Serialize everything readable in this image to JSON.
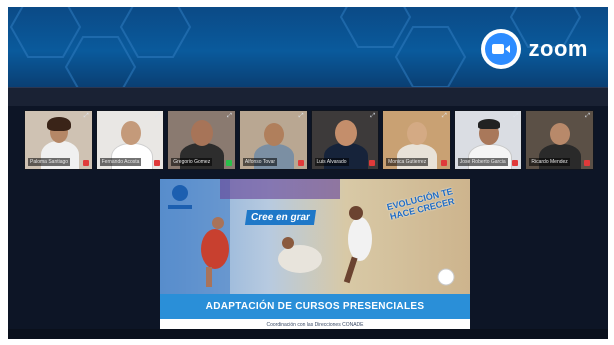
{
  "app": {
    "name": "zoom"
  },
  "participants": [
    {
      "name": "Paloma Santiago"
    },
    {
      "name": "Fernando Acosta"
    },
    {
      "name": "Gregorio Gomez"
    },
    {
      "name": "Alfonso Tovar"
    },
    {
      "name": "Luis Alvarado"
    },
    {
      "name": "Monica Gutierrez"
    },
    {
      "name": "Jose Roberto Garcia"
    },
    {
      "name": "Ricardo Mendez"
    }
  ],
  "share": {
    "title": "ADAPTACIÓN DE CURSOS PRESENCIALES",
    "subtitle": "Coordinación con las Direcciones CONADE",
    "slogan_left": "Cree en grar",
    "slogan_right": "EVOLUCIÓN TE HACE CRECER"
  }
}
